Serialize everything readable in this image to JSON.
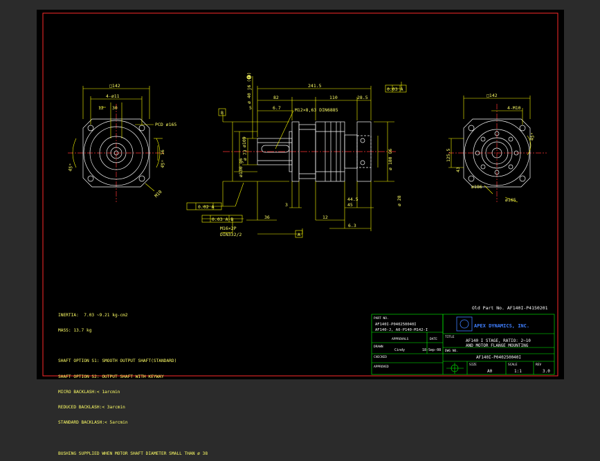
{
  "colors": {
    "background": "#000000",
    "frame": "#2b2b2b",
    "border": "#ff2a2a",
    "dim": "#ffff00",
    "geometry": "#ffffff",
    "center": "#ff3333",
    "titleblock": "#00ff00",
    "logo": "#3f7fff"
  },
  "left_view": {
    "square": "□142",
    "holes": "4-ø11",
    "pcd": "PCD ø165",
    "dim_12": "12",
    "dim_30": "30",
    "dim_16": "16",
    "dim_45_left": "45°",
    "dim_45_right": "45°",
    "dim_m": "M10"
  },
  "center_view": {
    "total_length": "241.5",
    "dim_82": "82",
    "dim_110": "110",
    "dim_28_5": "28.5",
    "dim_5": "5",
    "dim_6_7": "6.7",
    "keyway": "M12×8,63 DIN6885",
    "dia_40": "ø 40 j6 (🅔)",
    "dia_130": "ø130 g6",
    "dia_73": "ø 73",
    "dia_109": "ø109",
    "dia_180": "ø 180 G6",
    "dia_28": "ø 28",
    "flat_ref": "0.03 A",
    "gtol1": "0.02 A",
    "gtol2": "0.03 A-B",
    "thread": "M16×2P",
    "thread_std": "DIN332/2",
    "dim_36": "36",
    "dim_3": "3",
    "dim_12b": "12",
    "dim_45b": "45",
    "dim_44_5": "44.5",
    "dim_6_3": "6.3",
    "datum_a": "A",
    "datum_b": "B"
  },
  "right_view": {
    "square": "□142",
    "holes": "4-M10",
    "dim_45": "45°",
    "dia_186": "ø186",
    "dia_165": "ø165",
    "dim_43": "43",
    "dim_125_5": "125.5"
  },
  "notes": [
    "INERTIA:  7.03 ~9.21 kg-cm2",
    "MASS: 13.7 kg",
    "",
    "SHAFT OPTION S1: SMOOTH OUTPUT SHAFT(STANDARD)",
    "SHAFT OPTION S2: OUTPUT SHAFT WITH KEYWAY",
    "MICRO BACKLASH:< 1arcmin",
    "REDUCED BACKLASH:< 3arcmin",
    "STANDARD BACKLASH:< 5arcmin",
    "",
    "BUSHING SUPPLIED WHEN MOTOR SHAFT DIAMETER SMALL THAN ø 38"
  ],
  "old_part": "Old Part No. AF140I-P4150201",
  "title_block": {
    "part_no_label": "PART NO.",
    "part_no_1": "AF140I-P040250040I",
    "part_no_2": "AF140-J, A0-P140-M142-I",
    "company": "APEX DYNAMICS, INC.",
    "approvals": "APPROVALS",
    "date_label": "DATE",
    "title_label": "TITLE",
    "title_line1": "AF140 I STAGE, RATIO: 2~10",
    "title_line2": "AND MOTOR FLANGE MOUNTING",
    "drawn_label": "DRAWN",
    "drawn_by": "Cindy",
    "drawn_date": "18-Sep-08",
    "checked_label": "CHECKED",
    "dwg_no_label": "DWG NO.",
    "dwg_no": "AF140I-P040250040I",
    "approved_label": "APPROVED",
    "size_label": "SIZE",
    "size": "A0",
    "scale_label": "SCALE",
    "scale": "1:1",
    "rev_label": "REV",
    "rev": "3.0"
  }
}
